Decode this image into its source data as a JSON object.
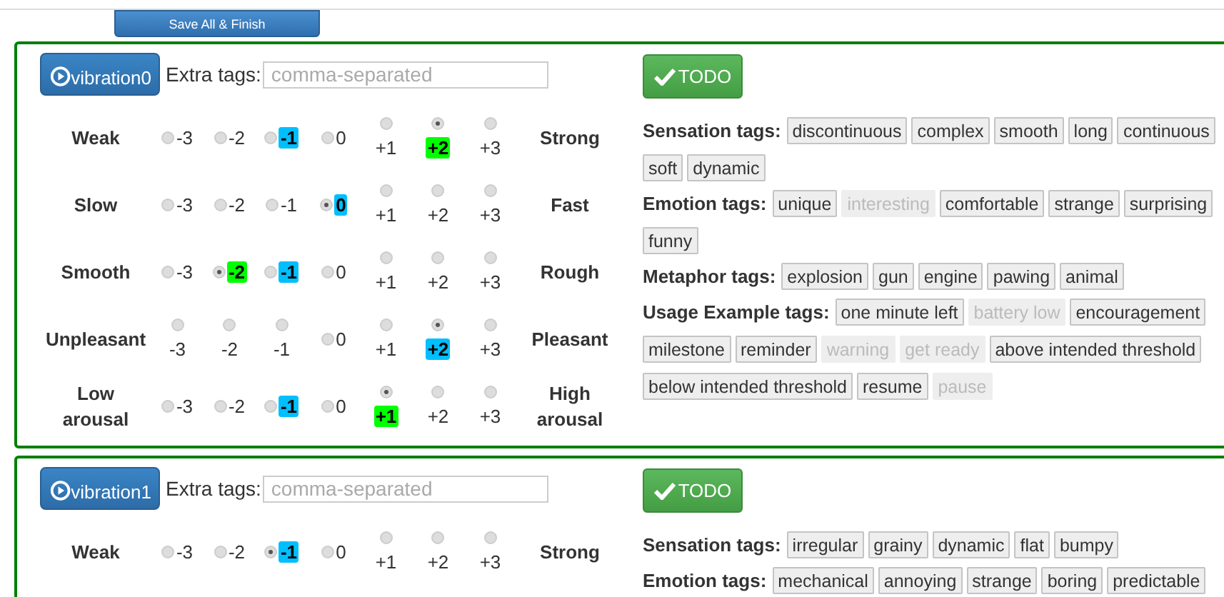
{
  "save_button": "Save All & Finish",
  "vibrations": [
    {
      "name": "vibration0",
      "extra_tags": {
        "label": "Extra tags:",
        "placeholder": "comma-separated"
      },
      "status_button": "TODO",
      "scales": [
        {
          "left": "Weak",
          "right": "Strong",
          "options": [
            {
              "value": "-3",
              "kind": "inline",
              "selected": false
            },
            {
              "value": "-2",
              "kind": "inline",
              "selected": false
            },
            {
              "value": "-1",
              "kind": "inline",
              "selected": false,
              "color": "#00bfff"
            },
            {
              "value": "0",
              "kind": "inline",
              "selected": false
            },
            {
              "value": "+1",
              "kind": "stacked",
              "selected": false
            },
            {
              "value": "+2",
              "kind": "stacked",
              "selected": true,
              "color": "#00ff00"
            },
            {
              "value": "+3",
              "kind": "stacked",
              "selected": false
            }
          ]
        },
        {
          "left": "Slow",
          "right": "Fast",
          "options": [
            {
              "value": "-3",
              "kind": "inline",
              "selected": false
            },
            {
              "value": "-2",
              "kind": "inline",
              "selected": false
            },
            {
              "value": "-1",
              "kind": "inline",
              "selected": false
            },
            {
              "value": "0",
              "kind": "inline",
              "selected": true,
              "color": "#00bfff"
            },
            {
              "value": "+1",
              "kind": "stacked",
              "selected": false
            },
            {
              "value": "+2",
              "kind": "stacked",
              "selected": false
            },
            {
              "value": "+3",
              "kind": "stacked",
              "selected": false
            }
          ]
        },
        {
          "left": "Smooth",
          "right": "Rough",
          "options": [
            {
              "value": "-3",
              "kind": "inline",
              "selected": false
            },
            {
              "value": "-2",
              "kind": "inline",
              "selected": true,
              "color": "#00ff00"
            },
            {
              "value": "-1",
              "kind": "inline",
              "selected": false,
              "color": "#00bfff"
            },
            {
              "value": "0",
              "kind": "inline",
              "selected": false
            },
            {
              "value": "+1",
              "kind": "stacked",
              "selected": false
            },
            {
              "value": "+2",
              "kind": "stacked",
              "selected": false
            },
            {
              "value": "+3",
              "kind": "stacked",
              "selected": false
            }
          ]
        },
        {
          "left": "Unpleasant",
          "right": "Pleasant",
          "options": [
            {
              "value": "-3",
              "kind": "stacked",
              "selected": false
            },
            {
              "value": "-2",
              "kind": "stacked",
              "selected": false
            },
            {
              "value": "-1",
              "kind": "stacked",
              "selected": false
            },
            {
              "value": "0",
              "kind": "inline",
              "selected": false
            },
            {
              "value": "+1",
              "kind": "stacked",
              "selected": false
            },
            {
              "value": "+2",
              "kind": "stacked",
              "selected": true,
              "color": "#00bfff"
            },
            {
              "value": "+3",
              "kind": "stacked",
              "selected": false
            }
          ]
        },
        {
          "left": "Low arousal",
          "right": "High arousal",
          "options": [
            {
              "value": "-3",
              "kind": "inline",
              "selected": false
            },
            {
              "value": "-2",
              "kind": "inline",
              "selected": false
            },
            {
              "value": "-1",
              "kind": "inline",
              "selected": false,
              "color": "#00bfff"
            },
            {
              "value": "0",
              "kind": "inline",
              "selected": false
            },
            {
              "value": "+1",
              "kind": "stacked",
              "selected": true,
              "color": "#00ff00"
            },
            {
              "value": "+2",
              "kind": "stacked",
              "selected": false
            },
            {
              "value": "+3",
              "kind": "stacked",
              "selected": false
            }
          ]
        }
      ],
      "tag_groups": [
        {
          "label": "Sensation tags:",
          "tags": [
            {
              "text": "discontinuous",
              "disabled": false
            },
            {
              "text": "complex",
              "disabled": false
            },
            {
              "text": "smooth",
              "disabled": false
            },
            {
              "text": "long",
              "disabled": false
            },
            {
              "text": "continuous",
              "disabled": false
            },
            {
              "text": "soft",
              "disabled": false
            },
            {
              "text": "dynamic",
              "disabled": false
            }
          ]
        },
        {
          "label": "Emotion tags:",
          "tags": [
            {
              "text": "unique",
              "disabled": false
            },
            {
              "text": "interesting",
              "disabled": true
            },
            {
              "text": "comfortable",
              "disabled": false
            },
            {
              "text": "strange",
              "disabled": false
            },
            {
              "text": "surprising",
              "disabled": false
            },
            {
              "text": "funny",
              "disabled": false
            }
          ]
        },
        {
          "label": "Metaphor tags:",
          "tags": [
            {
              "text": "explosion",
              "disabled": false
            },
            {
              "text": "gun",
              "disabled": false
            },
            {
              "text": "engine",
              "disabled": false
            },
            {
              "text": "pawing",
              "disabled": false
            },
            {
              "text": "animal",
              "disabled": false
            }
          ]
        },
        {
          "label": "Usage Example tags:",
          "tags": [
            {
              "text": "one minute left",
              "disabled": false
            },
            {
              "text": "battery low",
              "disabled": true
            },
            {
              "text": "encouragement",
              "disabled": false
            },
            {
              "text": "milestone",
              "disabled": false
            },
            {
              "text": "reminder",
              "disabled": false
            },
            {
              "text": "warning",
              "disabled": true
            },
            {
              "text": "get ready",
              "disabled": true
            },
            {
              "text": "above intended threshold",
              "disabled": false
            },
            {
              "text": "below intended threshold",
              "disabled": false
            },
            {
              "text": "resume",
              "disabled": false
            },
            {
              "text": "pause",
              "disabled": true
            }
          ]
        }
      ]
    },
    {
      "name": "vibration1",
      "extra_tags": {
        "label": "Extra tags:",
        "placeholder": "comma-separated"
      },
      "status_button": "TODO",
      "scales": [
        {
          "left": "Weak",
          "right": "Strong",
          "options": [
            {
              "value": "-3",
              "kind": "inline",
              "selected": false
            },
            {
              "value": "-2",
              "kind": "inline",
              "selected": false
            },
            {
              "value": "-1",
              "kind": "inline",
              "selected": true,
              "color": "#00bfff"
            },
            {
              "value": "0",
              "kind": "inline",
              "selected": false
            },
            {
              "value": "+1",
              "kind": "stacked",
              "selected": false
            },
            {
              "value": "+2",
              "kind": "stacked",
              "selected": false
            },
            {
              "value": "+3",
              "kind": "stacked",
              "selected": false
            }
          ]
        }
      ],
      "tag_groups": [
        {
          "label": "Sensation tags:",
          "tags": [
            {
              "text": "irregular",
              "disabled": false
            },
            {
              "text": "grainy",
              "disabled": false
            },
            {
              "text": "dynamic",
              "disabled": false
            },
            {
              "text": "flat",
              "disabled": false
            },
            {
              "text": "bumpy",
              "disabled": false
            }
          ]
        },
        {
          "label": "Emotion tags:",
          "tags": [
            {
              "text": "mechanical",
              "disabled": false
            },
            {
              "text": "annoying",
              "disabled": false
            },
            {
              "text": "strange",
              "disabled": false
            },
            {
              "text": "boring",
              "disabled": false
            },
            {
              "text": "predictable",
              "disabled": false
            }
          ]
        }
      ]
    }
  ]
}
